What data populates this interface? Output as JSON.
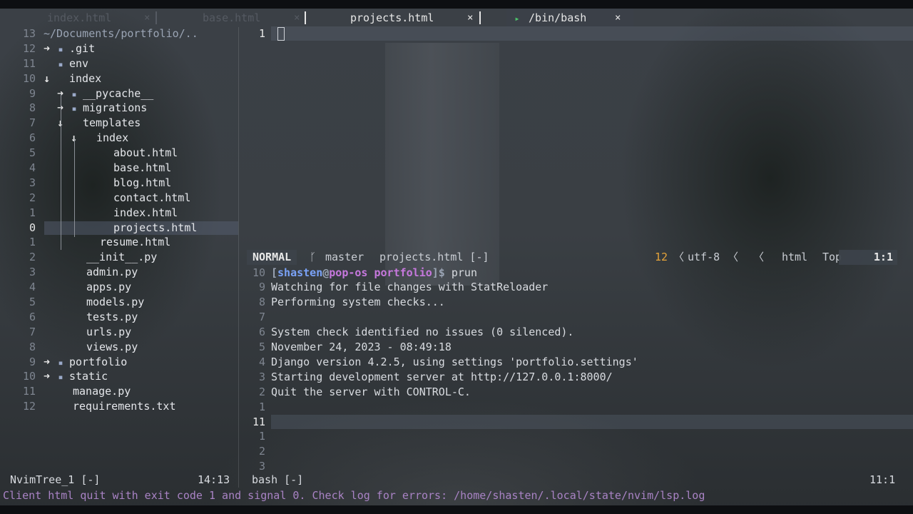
{
  "tabs": [
    {
      "icon": "html-file-icon",
      "glyph": "",
      "label": "index.html",
      "close": "×",
      "active": false
    },
    {
      "icon": "html-file-icon",
      "glyph": "",
      "label": "base.html",
      "close": "×",
      "active": false
    },
    {
      "icon": "html-file-icon",
      "glyph": "",
      "label": "projects.html",
      "close": "×",
      "active": false
    },
    {
      "icon": "terminal-icon",
      "glyph": "▸",
      "label": "/bin/bash",
      "close": "×",
      "active": true
    }
  ],
  "colors": {
    "tab_active_bg": "#3b4048",
    "html_icon": "#d7663c",
    "py_icon": "#f0c531",
    "txt_icon": "#4cc46a",
    "message": "#a983c5"
  },
  "tree": {
    "root": {
      "ln": "13",
      "label": "~/Documents/portfolio/.."
    },
    "rows": [
      {
        "ln": "12",
        "arrow": "➜",
        "icon": "folder",
        "label": ".git",
        "depth": 0
      },
      {
        "ln": "11",
        "arrow": "",
        "icon": "folder",
        "label": "env",
        "depth": 0
      },
      {
        "ln": "10",
        "arrow": "↓",
        "icon": "folder-open",
        "label": "index",
        "depth": 0
      },
      {
        "ln": "9",
        "arrow": "➜",
        "icon": "folder",
        "label": "__pycache__",
        "depth": 1
      },
      {
        "ln": "8",
        "arrow": "➜",
        "icon": "folder",
        "label": "migrations",
        "depth": 1
      },
      {
        "ln": "7",
        "arrow": "↓",
        "icon": "folder-open",
        "label": "templates",
        "depth": 1
      },
      {
        "ln": "6",
        "arrow": "↓",
        "icon": "folder-open",
        "label": "index",
        "depth": 2
      },
      {
        "ln": "5",
        "arrow": "",
        "icon": "html",
        "label": "about.html",
        "depth": 3
      },
      {
        "ln": "4",
        "arrow": "",
        "icon": "html",
        "label": "base.html",
        "depth": 3
      },
      {
        "ln": "3",
        "arrow": "",
        "icon": "html",
        "label": "blog.html",
        "depth": 3
      },
      {
        "ln": "2",
        "arrow": "",
        "icon": "html",
        "label": "contact.html",
        "depth": 3
      },
      {
        "ln": "1",
        "arrow": "",
        "icon": "html",
        "label": "index.html",
        "depth": 3
      },
      {
        "ln": "0",
        "arrow": "",
        "icon": "html",
        "label": "projects.html",
        "depth": 3,
        "selected": true
      },
      {
        "ln": "1",
        "arrow": "",
        "icon": "html",
        "label": "resume.html",
        "depth": 2
      },
      {
        "ln": "2",
        "arrow": "",
        "icon": "py",
        "label": "__init__.py",
        "depth": 1
      },
      {
        "ln": "3",
        "arrow": "",
        "icon": "py",
        "label": "admin.py",
        "depth": 1
      },
      {
        "ln": "4",
        "arrow": "",
        "icon": "py",
        "label": "apps.py",
        "depth": 1
      },
      {
        "ln": "5",
        "arrow": "",
        "icon": "py",
        "label": "models.py",
        "depth": 1
      },
      {
        "ln": "6",
        "arrow": "",
        "icon": "py",
        "label": "tests.py",
        "depth": 1
      },
      {
        "ln": "7",
        "arrow": "",
        "icon": "py",
        "label": "urls.py",
        "depth": 1
      },
      {
        "ln": "8",
        "arrow": "",
        "icon": "py",
        "label": "views.py",
        "depth": 1
      },
      {
        "ln": "9",
        "arrow": "➜",
        "icon": "folder",
        "label": "portfolio",
        "depth": 0
      },
      {
        "ln": "10",
        "arrow": "➜",
        "icon": "folder",
        "label": "static",
        "depth": 0
      },
      {
        "ln": "11",
        "arrow": "",
        "icon": "py",
        "label": "manage.py",
        "depth": 0
      },
      {
        "ln": "12",
        "arrow": "",
        "icon": "txt",
        "label": "requirements.txt",
        "depth": 0
      }
    ]
  },
  "editor": {
    "line_number": "1"
  },
  "statusline": {
    "mode": "NORMAL",
    "branch_icon": "ᚴ",
    "branch": "master",
    "filename": "projects.html [-]",
    "lsp_icon": "",
    "lsp_count": "12",
    "encoding": "utf-8",
    "os_icon": "",
    "ft_icon": "",
    "filetype": "html",
    "scroll": "Top",
    "position": "1:1"
  },
  "terminal": {
    "prompt_user": "shasten",
    "prompt_at": "@",
    "prompt_host": "pop-os",
    "prompt_dir": "portfolio",
    "prompt_command": "prun",
    "lines": [
      {
        "ln": "10",
        "text": ""
      },
      {
        "ln": "9",
        "text": "Watching for file changes with StatReloader"
      },
      {
        "ln": "8",
        "text": "Performing system checks..."
      },
      {
        "ln": "7",
        "text": ""
      },
      {
        "ln": "6",
        "text": "System check identified no issues (0 silenced)."
      },
      {
        "ln": "5",
        "text": "November 24, 2023 - 08:49:18"
      },
      {
        "ln": "4",
        "text": "Django version 4.2.5, using settings 'portfolio.settings'"
      },
      {
        "ln": "3",
        "text": "Starting development server at http://127.0.0.1:8000/"
      },
      {
        "ln": "2",
        "text": "Quit the server with CONTROL-C."
      },
      {
        "ln": "1",
        "text": ""
      },
      {
        "ln": "11",
        "text": ""
      },
      {
        "ln": "1",
        "text": ""
      },
      {
        "ln": "2",
        "text": ""
      },
      {
        "ln": "3",
        "text": ""
      }
    ]
  },
  "bottom": {
    "tree_name": "NvimTree_1 [-]",
    "tree_pos": "14:13",
    "term_name": "bash [-]",
    "term_pos": "11:1"
  },
  "message": "Client html quit with exit code 1 and signal 0. Check log for errors: /home/shasten/.local/state/nvim/lsp.log"
}
